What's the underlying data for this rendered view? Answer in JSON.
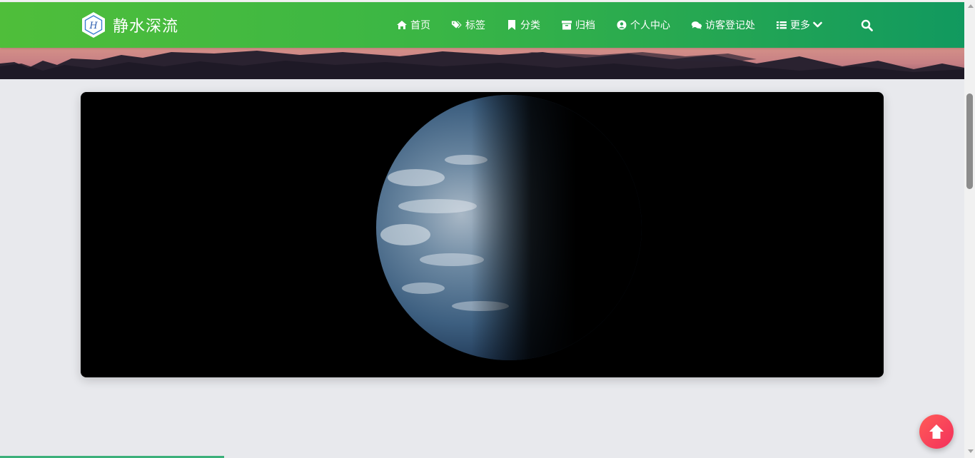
{
  "brand": {
    "name": "静水深流",
    "logo_icon": "hexagon-logo-icon"
  },
  "nav": {
    "items": [
      {
        "label": "首页",
        "icon": "home-icon"
      },
      {
        "label": "标签",
        "icon": "tags-icon"
      },
      {
        "label": "分类",
        "icon": "bookmark-icon"
      },
      {
        "label": "归档",
        "icon": "archive-icon"
      },
      {
        "label": "个人中心",
        "icon": "user-circle-icon"
      },
      {
        "label": "访客登记处",
        "icon": "comments-icon"
      },
      {
        "label": "更多",
        "icon": "list-icon",
        "dropdown": true
      }
    ],
    "search_icon": "search-icon"
  },
  "hero": {
    "image": "sunset-lake-banner"
  },
  "main": {
    "image": "earth-from-space"
  },
  "back_to_top": {
    "icon": "arrow-up-icon"
  },
  "read_progress": 0.23,
  "colors": {
    "nav_gradient_start": "#4fbe3a",
    "nav_gradient_end": "#11995f",
    "page_background": "#e8e9ed",
    "back_to_top": "#f3305c",
    "progress": "#3bb07a"
  }
}
